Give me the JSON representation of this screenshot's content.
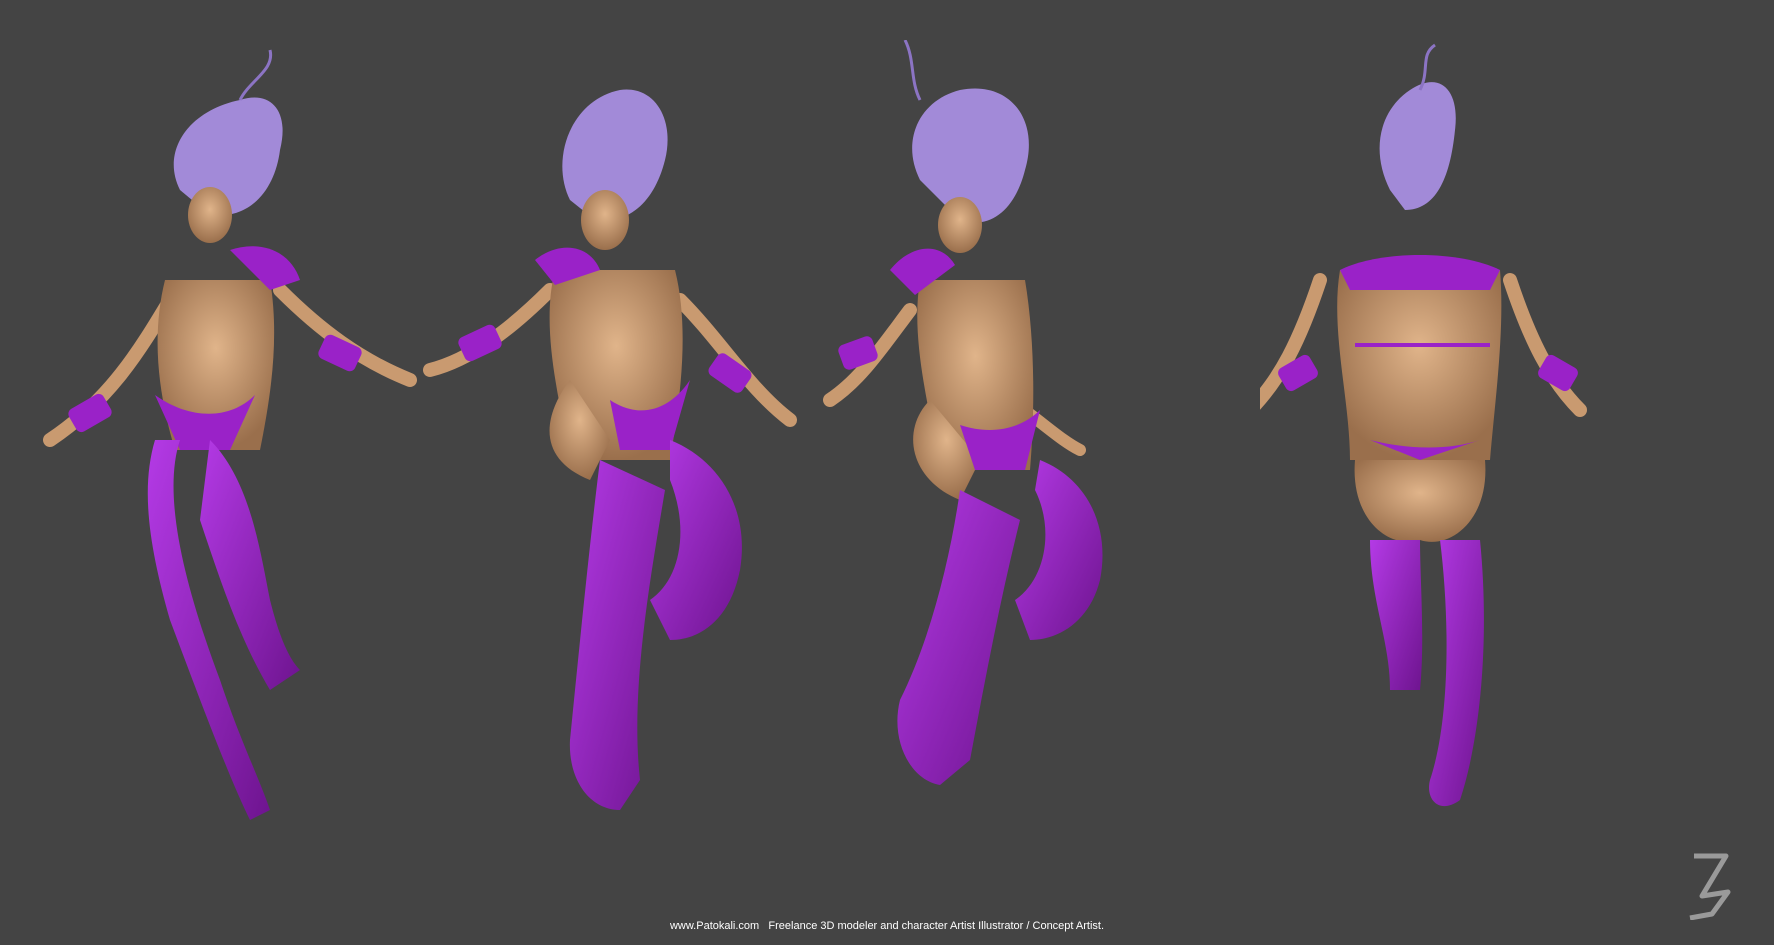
{
  "image": {
    "description": "Turnaround render of a 3D female character model shown in four floating poses against a dark gray background",
    "background_color": "#444444",
    "colors": {
      "skin": "#c99a70",
      "costume": "#9a22c8",
      "hair": "#a28ad8"
    },
    "views": [
      {
        "name": "front-three-quarter-left"
      },
      {
        "name": "front-three-quarter-right"
      },
      {
        "name": "side-three-quarter"
      },
      {
        "name": "back"
      }
    ]
  },
  "footer": {
    "site": "www.Patokali.com",
    "tagline": "Freelance 3D modeler and character Artist Illustrator / Concept Artist."
  },
  "watermark": {
    "icon": "signature-glyph-icon"
  }
}
